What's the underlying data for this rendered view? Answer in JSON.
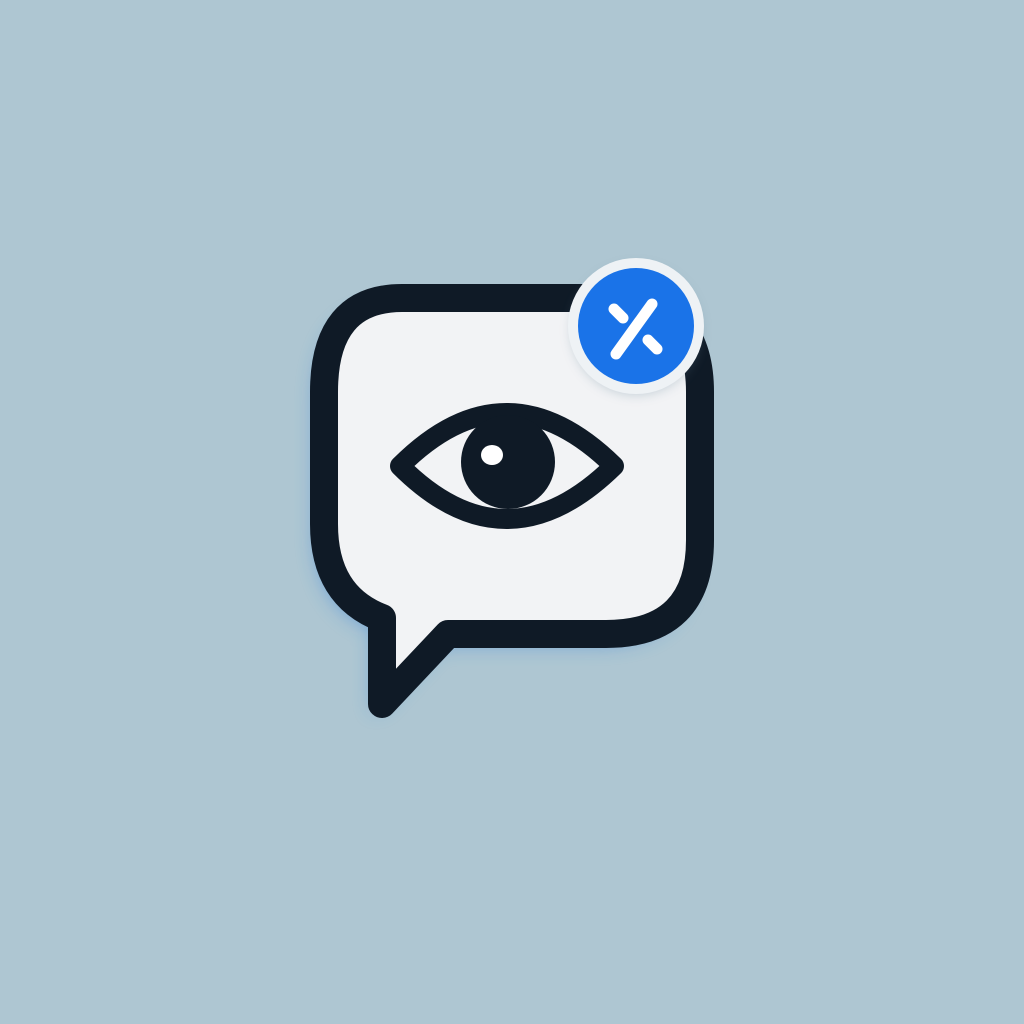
{
  "canvas": {
    "background_color": "#aec6d2"
  },
  "icon": {
    "name": "chat-bubble-with-eye-icon",
    "bubble_fill": "#f2f3f5",
    "outline_color": "#0f1a26",
    "shadow_color": "#2f7fd8"
  },
  "badge": {
    "icon": "percent-icon",
    "fill_color": "#1a73e8",
    "symbol_color": "#ffffff"
  }
}
